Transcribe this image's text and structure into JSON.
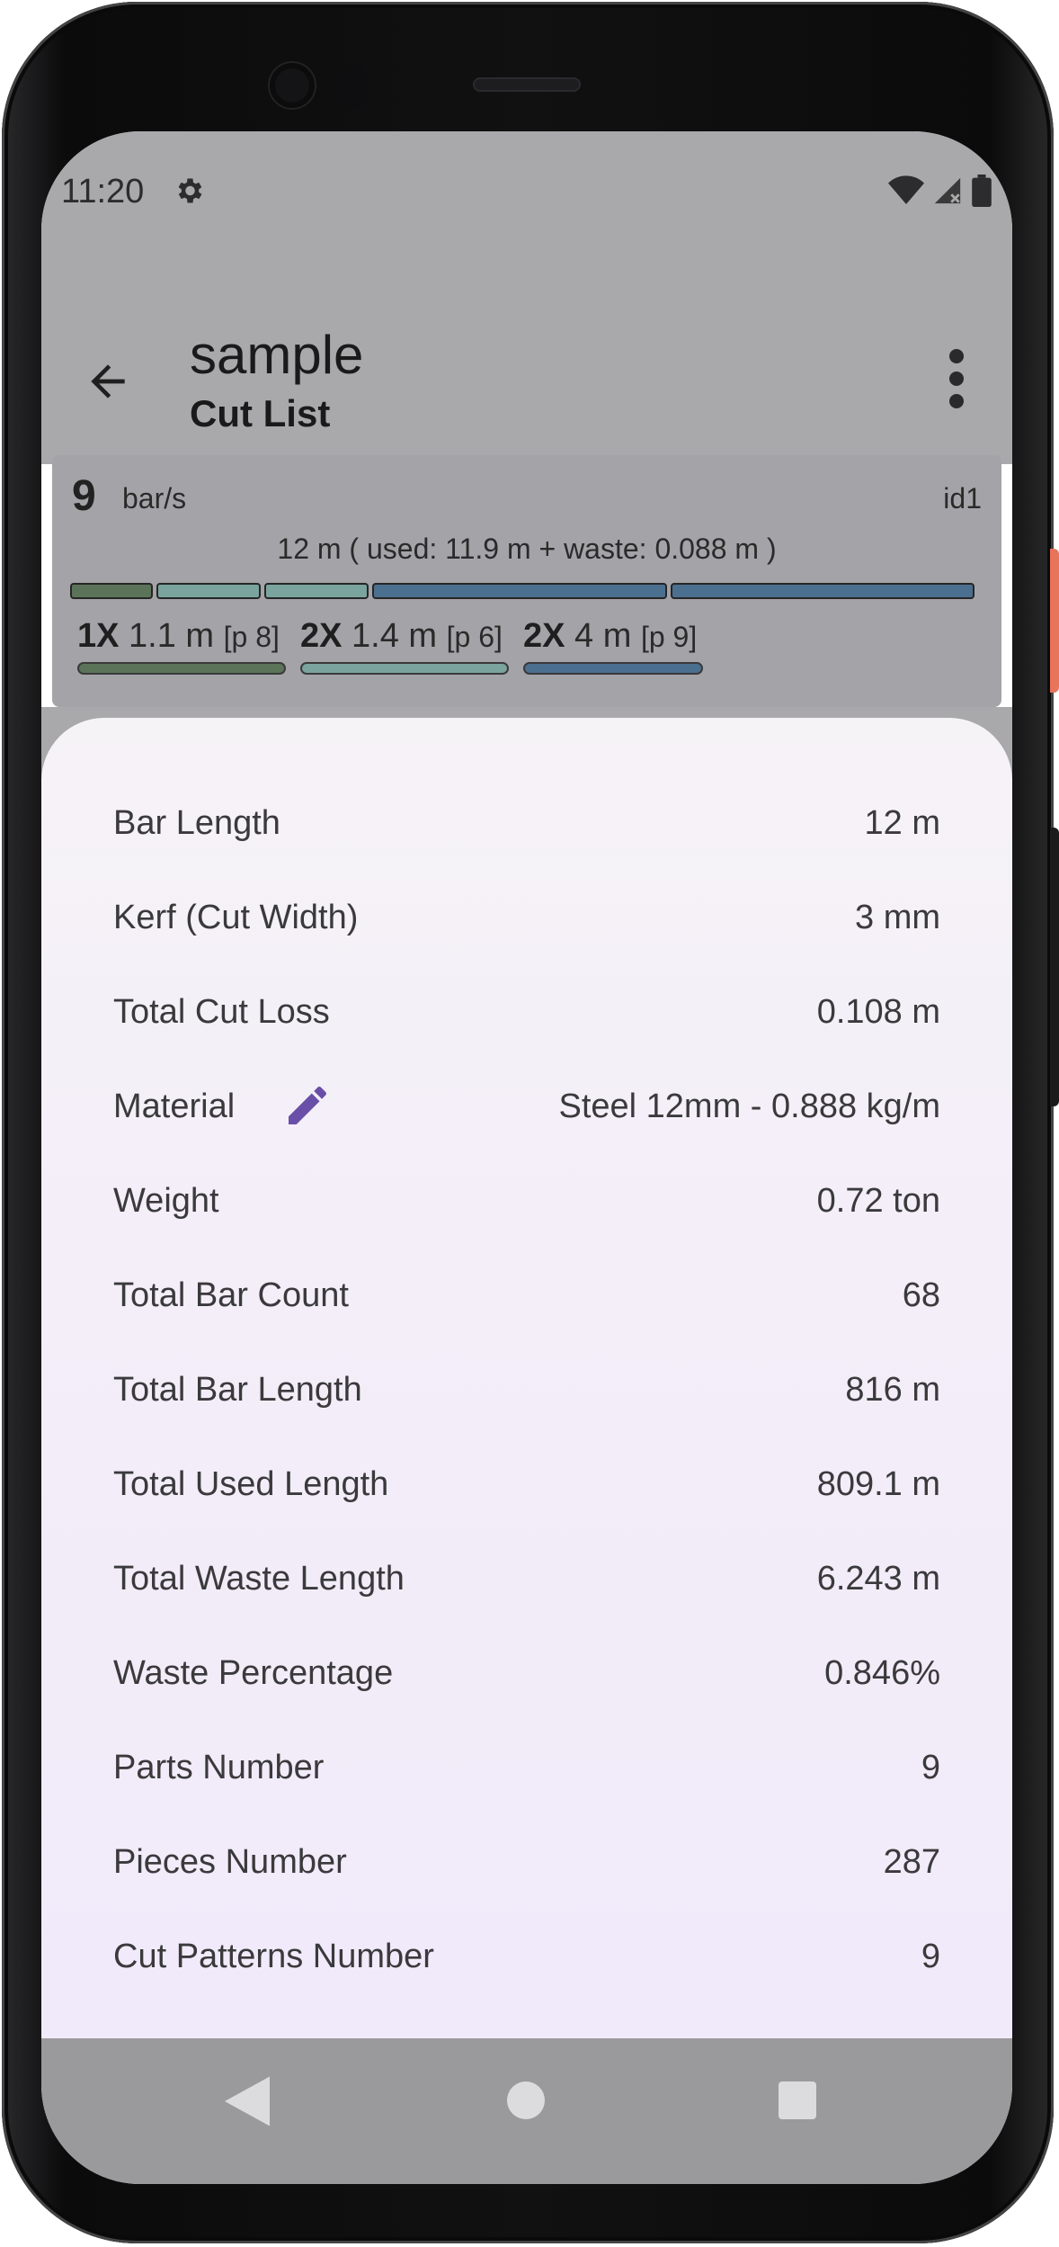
{
  "status_bar": {
    "time": "11:20"
  },
  "app_bar": {
    "title": "sample",
    "subtitle": "Cut List"
  },
  "bar_card": {
    "count": "9",
    "unit": "bar/s",
    "id": "id1",
    "summary": "12 m ( used: 11.9 m + waste: 0.088 m )",
    "segment_colors": [
      "#5b7459",
      "#7aa49d",
      "#7aa49d",
      "#4b6f8f",
      "#4b6f8f"
    ],
    "parts": [
      {
        "qty": "1X",
        "length": "1.1 m",
        "pattern": "[p 8]",
        "color": "#5b7459"
      },
      {
        "qty": "2X",
        "length": "1.4 m",
        "pattern": "[p 6]",
        "color": "#7aa49d"
      },
      {
        "qty": "2X",
        "length": "4 m",
        "pattern": "[p 9]",
        "color": "#4b6f8f"
      }
    ]
  },
  "details": {
    "rows": [
      {
        "label": "Bar Length",
        "value": "12 m"
      },
      {
        "label": "Kerf (Cut Width)",
        "value": "3 mm"
      },
      {
        "label": "Total Cut Loss",
        "value": "0.108 m"
      },
      {
        "label": "Material",
        "value": "Steel 12mm - 0.888 kg/m"
      },
      {
        "label": "Weight",
        "value": "0.72 ton"
      },
      {
        "label": "Total Bar Count",
        "value": "68"
      },
      {
        "label": "Total Bar Length",
        "value": "816 m"
      },
      {
        "label": "Total Used Length",
        "value": "809.1 m"
      },
      {
        "label": "Total Waste Length",
        "value": "6.243 m"
      },
      {
        "label": "Waste Percentage",
        "value": "0.846%"
      },
      {
        "label": "Parts Number",
        "value": "9"
      },
      {
        "label": "Pieces Number",
        "value": "287"
      },
      {
        "label": "Cut Patterns Number",
        "value": "9"
      }
    ]
  },
  "icons": {
    "settings": "gear-icon",
    "wifi": "wifi-icon",
    "signal": "signal-icon",
    "battery": "battery-icon",
    "back": "arrow-back-icon",
    "more": "more-vert-icon",
    "edit": "pencil-icon",
    "nav_back": "nav-back-icon",
    "nav_home": "nav-home-icon",
    "nav_recent": "nav-recent-icon"
  },
  "colors": {
    "accent": "#6a4fa8",
    "scrim": "#a9a8ab"
  }
}
